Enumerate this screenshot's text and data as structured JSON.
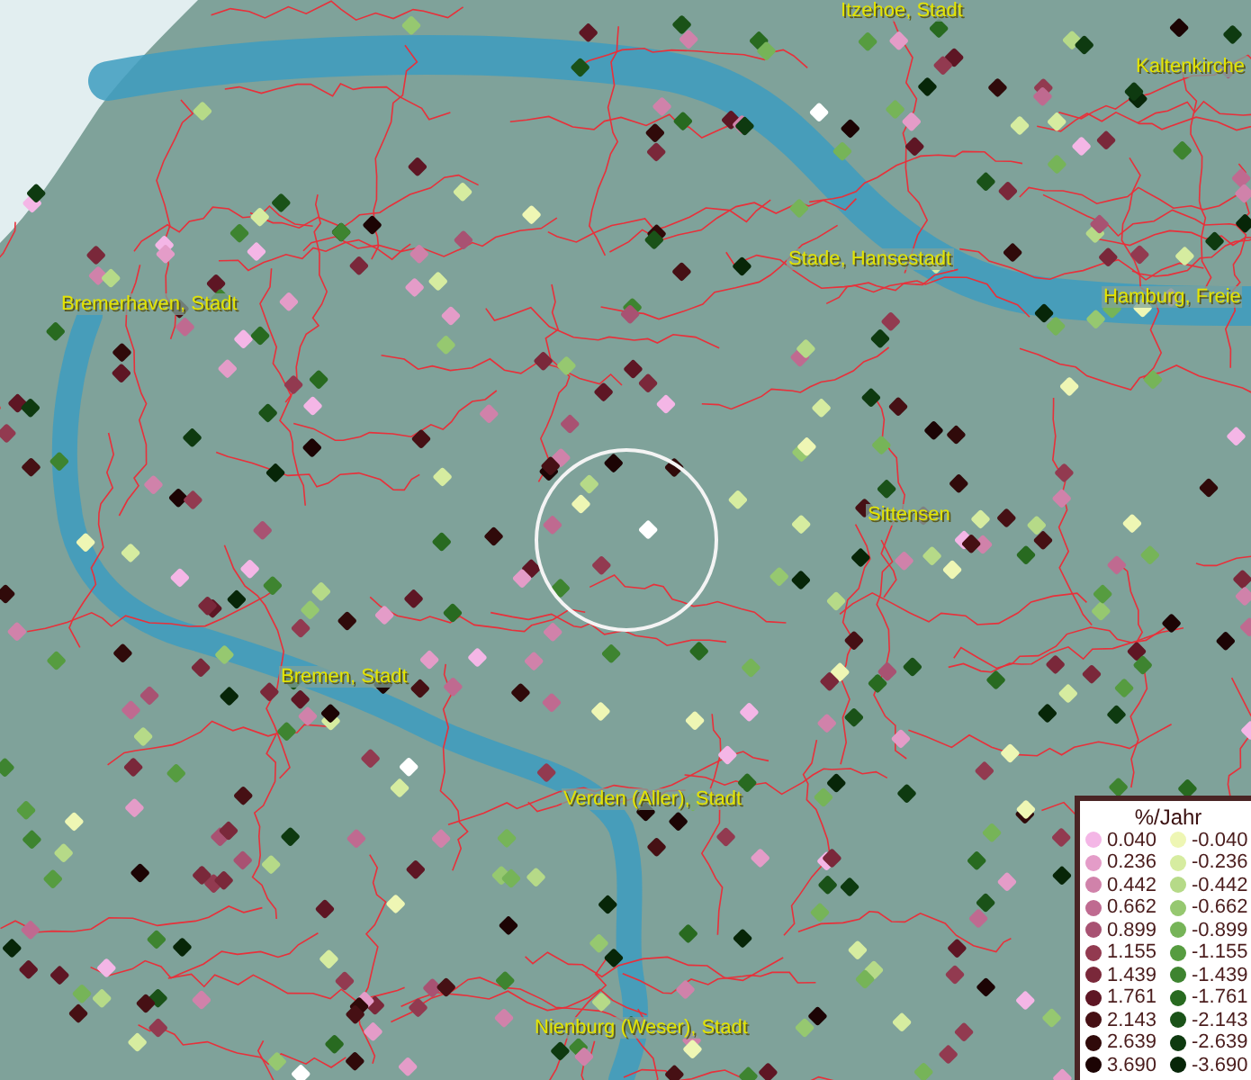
{
  "places": [
    {
      "name": "Itzehoe, Stadt"
    },
    {
      "name": "Kaltenkirche"
    },
    {
      "name": "Stade, Hansestadt"
    },
    {
      "name": "Bremerhaven, Stadt"
    },
    {
      "name": "Hamburg, Freie"
    },
    {
      "name": "Sittensen"
    },
    {
      "name": "Bremen, Stadt"
    },
    {
      "name": "Verden (Aller), Stadt"
    },
    {
      "name": "Nienburg (Weser), Stadt"
    }
  ],
  "legend": {
    "title": "%/Jahr",
    "increase": [
      {
        "label": "0.040",
        "color": "#f4b6e6"
      },
      {
        "label": "0.236",
        "color": "#e49cc8"
      },
      {
        "label": "0.442",
        "color": "#d082aa"
      },
      {
        "label": "0.662",
        "color": "#bf6a90"
      },
      {
        "label": "0.899",
        "color": "#a85272"
      },
      {
        "label": "1.155",
        "color": "#923a50"
      },
      {
        "label": "1.439",
        "color": "#7a283a"
      },
      {
        "label": "1.761",
        "color": "#5e1624"
      },
      {
        "label": "2.143",
        "color": "#461014"
      },
      {
        "label": "2.639",
        "color": "#300a0a"
      },
      {
        "label": "3.690",
        "color": "#1c0404"
      }
    ],
    "decrease": [
      {
        "label": "-0.040",
        "color": "#eef6b4"
      },
      {
        "label": "-0.236",
        "color": "#d6eca0"
      },
      {
        "label": "-0.442",
        "color": "#b6da88"
      },
      {
        "label": "-0.662",
        "color": "#96c870"
      },
      {
        "label": "-0.899",
        "color": "#76b458"
      },
      {
        "label": "-1.155",
        "color": "#569c40"
      },
      {
        "label": "-1.439",
        "color": "#3e8430"
      },
      {
        "label": "-1.761",
        "color": "#286a20"
      },
      {
        "label": "-2.143",
        "color": "#1a5218"
      },
      {
        "label": "-2.639",
        "color": "#0e3a10"
      },
      {
        "label": "-3.690",
        "color": "#072608"
      }
    ]
  }
}
